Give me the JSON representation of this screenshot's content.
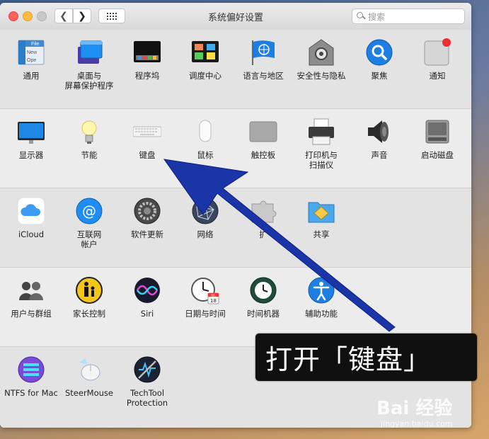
{
  "window": {
    "title": "系统偏好设置"
  },
  "search": {
    "placeholder": "搜索"
  },
  "rows": [
    [
      {
        "label": "通用",
        "icon": "general-icon"
      },
      {
        "label": "桌面与",
        "label2": "屏幕保护程序",
        "icon": "desktop-screensaver-icon"
      },
      {
        "label": "程序坞",
        "icon": "dock-icon"
      },
      {
        "label": "调度中心",
        "icon": "mission-control-icon"
      },
      {
        "label": "语言与地区",
        "icon": "language-region-icon"
      },
      {
        "label": "安全性与隐私",
        "icon": "security-privacy-icon"
      },
      {
        "label": "聚焦",
        "icon": "spotlight-icon"
      },
      {
        "label": "通知",
        "icon": "notifications-icon"
      }
    ],
    [
      {
        "label": "显示器",
        "icon": "displays-icon"
      },
      {
        "label": "节能",
        "icon": "energy-saver-icon"
      },
      {
        "label": "键盘",
        "icon": "keyboard-icon"
      },
      {
        "label": "鼠标",
        "icon": "mouse-icon"
      },
      {
        "label": "触控板",
        "icon": "trackpad-icon"
      },
      {
        "label": "打印机与",
        "label2": "扫描仪",
        "icon": "printers-scanners-icon"
      },
      {
        "label": "声音",
        "icon": "sound-icon"
      },
      {
        "label": "启动磁盘",
        "icon": "startup-disk-icon"
      }
    ],
    [
      {
        "label": "iCloud",
        "icon": "icloud-icon"
      },
      {
        "label": "互联网",
        "label2": "帐户",
        "icon": "internet-accounts-icon"
      },
      {
        "label": "软件更新",
        "icon": "software-update-icon"
      },
      {
        "label": "网络",
        "icon": "network-icon"
      },
      {
        "label": "扩",
        "icon": "extensions-icon"
      },
      {
        "label": "共享",
        "icon": "sharing-icon"
      }
    ],
    [
      {
        "label": "用户与群组",
        "icon": "users-groups-icon"
      },
      {
        "label": "家长控制",
        "icon": "parental-controls-icon"
      },
      {
        "label": "Siri",
        "icon": "siri-icon"
      },
      {
        "label": "日期与时间",
        "icon": "date-time-icon"
      },
      {
        "label": "时间机器",
        "icon": "time-machine-icon"
      },
      {
        "label": "辅助功能",
        "icon": "accessibility-icon"
      }
    ],
    [
      {
        "label": "NTFS for Mac",
        "icon": "ntfs-for-mac-icon"
      },
      {
        "label": "SteerMouse",
        "icon": "steermouse-icon"
      },
      {
        "label": "TechTool",
        "label2": "Protection",
        "icon": "techtool-protection-icon"
      }
    ]
  ],
  "calendar_icon": {
    "month": "JUL",
    "day": "18"
  },
  "general_icon": {
    "line1": "File",
    "line2": "New",
    "line3": "Ope"
  },
  "annotation": {
    "text": "打开「键盘」"
  },
  "watermark": {
    "text": "Bai 经验",
    "sub": "jingyan.baidu.com"
  },
  "colors": {
    "arrow": "#1a35a8",
    "annotation_bg": "#101010"
  }
}
